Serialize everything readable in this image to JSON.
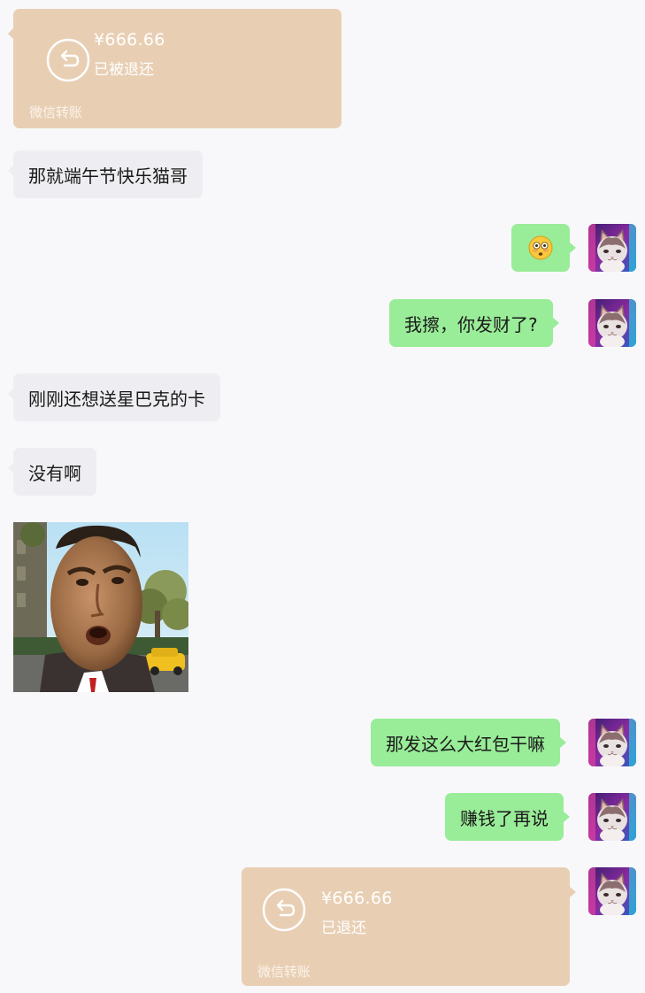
{
  "messages": {
    "transfer_in": {
      "amount": "¥666.66",
      "status": "已被退还",
      "footer": "微信转账"
    },
    "m1": "那就端午节快乐猫哥",
    "emoji_name": "flushed-face-emoji",
    "m2": "我擦，你发财了?",
    "m3": "刚刚还想送星巴克的卡",
    "m4": "没有啊",
    "sticker_name": "meme-sticker-face",
    "m5": "那发这么大红包干嘛",
    "m6": "赚钱了再说",
    "transfer_out": {
      "amount": "¥666.66",
      "status": "已退还",
      "footer": "微信转账"
    }
  },
  "colors": {
    "background": "#f8f8fa",
    "bubble_incoming": "#eeeef2",
    "bubble_outgoing": "#99ec98",
    "transfer_card": "#e8cfb4"
  },
  "icons": {
    "transfer_return": "return-arrow-icon",
    "avatar": "cat-avatar"
  }
}
